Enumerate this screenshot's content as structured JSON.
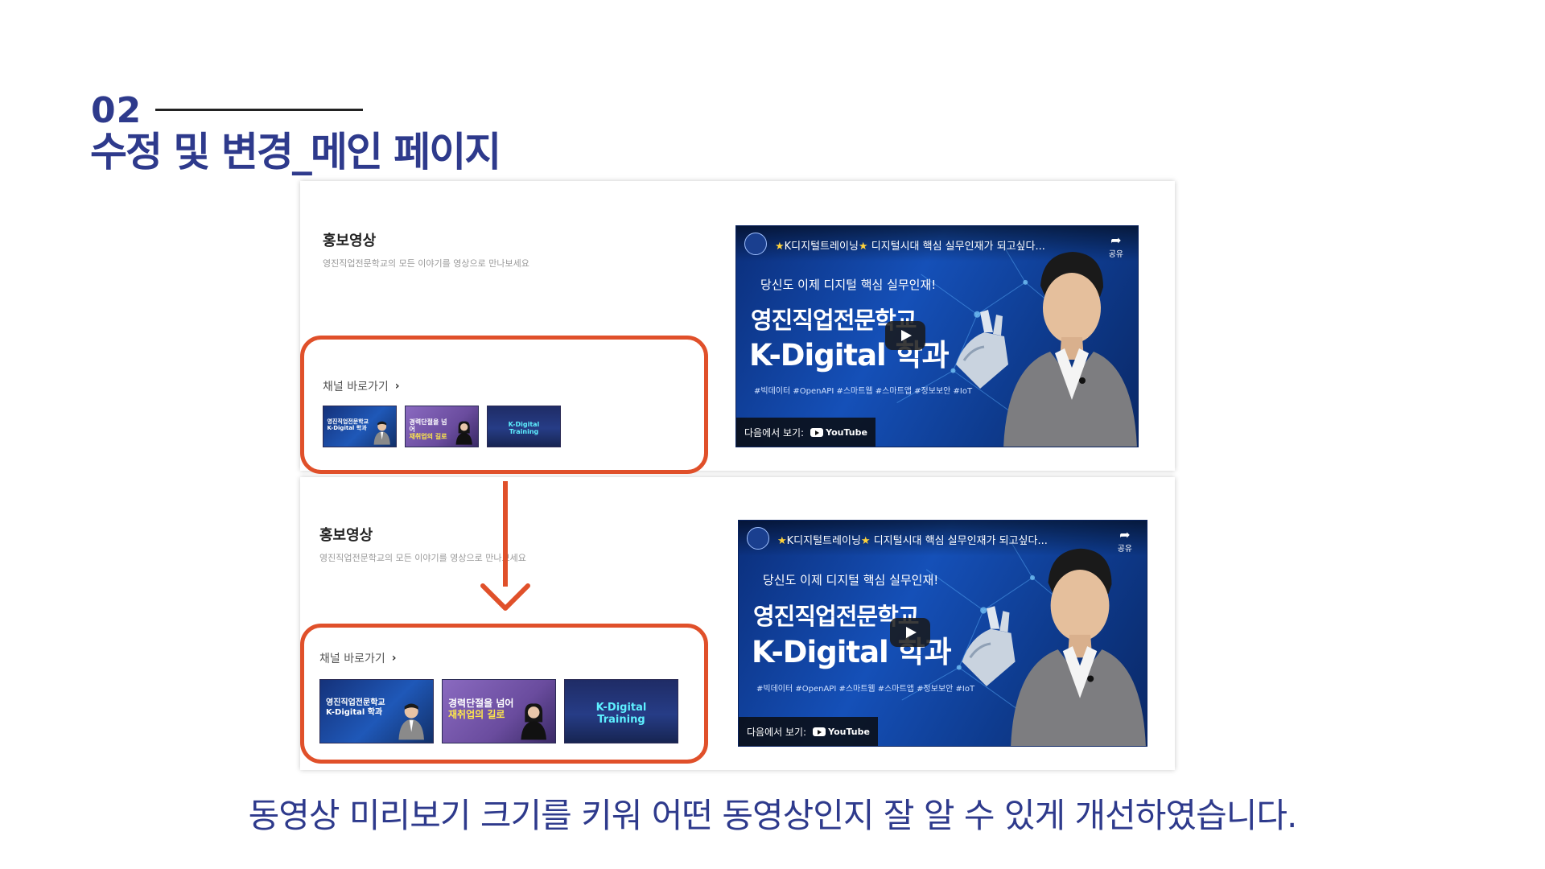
{
  "header": {
    "section_number": "02",
    "section_title": "수정 및 변경_메인 페이지"
  },
  "before": {
    "title": "홍보영상",
    "subtitle": "영진직업전문학교의 모든 이야기를 영상으로 만나보세요",
    "channel_link": "채널 바로가기"
  },
  "after": {
    "title": "홍보영상",
    "subtitle": "영진직업전문학교의 모든 이야기를 영상으로 만나보세요",
    "channel_link": "채널 바로가기"
  },
  "thumbnails": [
    {
      "line1": "영진직업전문학교",
      "line2": "K-Digital 학과"
    },
    {
      "line1": "경력단절을 넘어",
      "line2": "재취업의 길로"
    },
    {
      "line1": "K-Digital Training",
      "line2": ""
    }
  ],
  "video": {
    "title_star1": "★",
    "title_text1": "K디지털트레이닝",
    "title_star2": "★",
    "title_text2": " 디지털시대 핵심 실무인재가 되고싶다...",
    "share_label": "공유",
    "handwritten": "당신도 이제 디지털 핵심 실무인재!",
    "school": "영진직업전문학교",
    "headline": "K-Digital 학과",
    "tags": "#빅데이터 #OpenAPI #스마트웹 #스마트앱 #정보보안 #IoT",
    "watch_on": "다음에서 보기:",
    "youtube": "YouTube"
  },
  "caption": "동영상 미리보기 크기를 키워 어떤 동영상인지 잘 알 수 있게 개선하였습니다.",
  "colors": {
    "heading_blue": "#2e3a8c",
    "highlight_red": "#e0502a",
    "video_blue": "#1550b8"
  },
  "icons": [
    "chevron-right-icon",
    "share-icon",
    "play-icon",
    "youtube-icon",
    "down-arrow-icon"
  ]
}
